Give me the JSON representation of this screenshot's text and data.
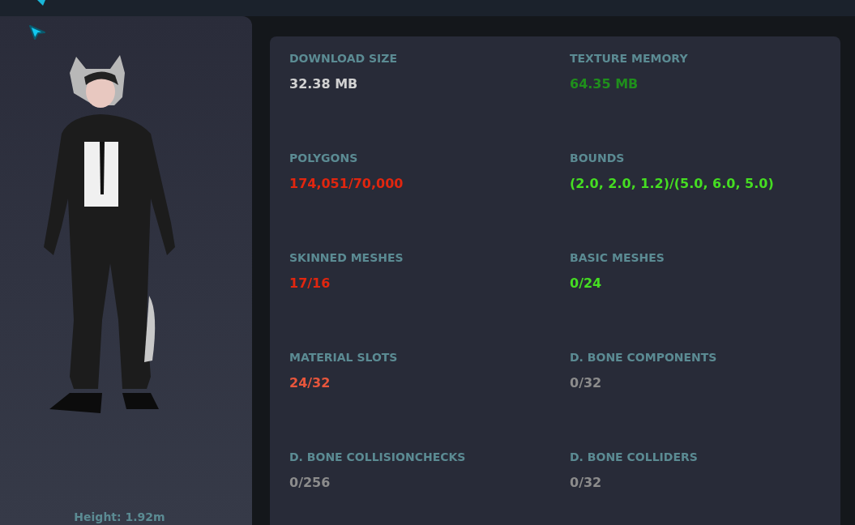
{
  "avatar_panel": {
    "height_label": "Height: 1.92m"
  },
  "stats": [
    {
      "label": "DOWNLOAD SIZE",
      "value": "32.38 MB",
      "color": "#d2d2d2"
    },
    {
      "label": "TEXTURE MEMORY",
      "value": "64.35 MB",
      "color": "#1f8f1c"
    },
    {
      "label": "POLYGONS",
      "value": "174,051/70,000",
      "color": "#e1260f"
    },
    {
      "label": "BOUNDS",
      "value": "(2.0, 2.0, 1.2)/(5.0, 6.0, 5.0)",
      "color": "#45dd22"
    },
    {
      "label": "SKINNED MESHES",
      "value": "17/16",
      "color": "#e1260f"
    },
    {
      "label": "BASIC MESHES",
      "value": "0/24",
      "color": "#45dd22"
    },
    {
      "label": "MATERIAL SLOTS",
      "value": "24/32",
      "color": "#e8563c"
    },
    {
      "label": "D. BONE COMPONENTS",
      "value": "0/32",
      "color": "#8c8c8c"
    },
    {
      "label": "D. BONE COLLISIONCHECKS",
      "value": "0/256",
      "color": "#8c8c8c"
    },
    {
      "label": "D. BONE COLLIDERS",
      "value": "0/32",
      "color": "#8c8c8c"
    }
  ]
}
